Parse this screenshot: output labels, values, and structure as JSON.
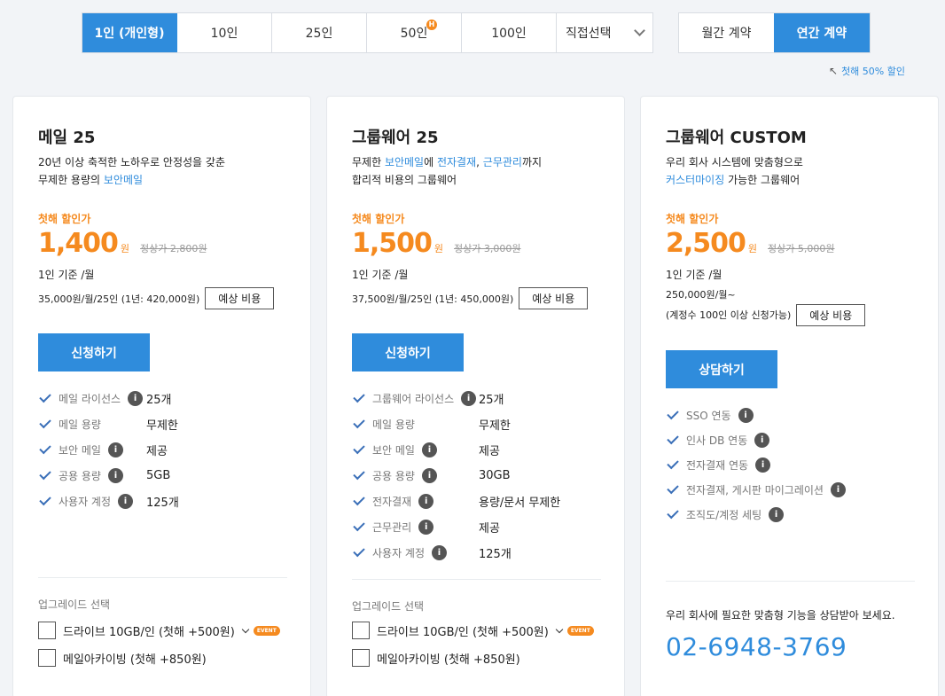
{
  "user_tabs": [
    {
      "label": "1인 (개인형)",
      "active": true
    },
    {
      "label": "10인"
    },
    {
      "label": "25인"
    },
    {
      "label": "50인",
      "badge": "H"
    },
    {
      "label": "100인"
    }
  ],
  "user_select_label": "직접선택",
  "contract_tabs": [
    {
      "label": "월간 계약"
    },
    {
      "label": "연간 계약",
      "active": true
    }
  ],
  "discount_note": "첫해 50% 할인",
  "cards": [
    {
      "name": "메일 25",
      "desc_line1": "20년 이상 축적한 노하우로 안정성을 갖춘",
      "desc_line2_pre": "무제한 용량의 ",
      "desc_line2_hl": "보안메일",
      "promo_label": "첫해 할인가",
      "price": "1,400",
      "won": "원",
      "original": "정상가 2,800원",
      "per": "1인 기준 /월",
      "calc": "35,000원/월/25인 (1년: 420,000원)",
      "estimate_label": "예상 비용",
      "button": "신청하기",
      "features": [
        {
          "name": "메일 라이선스",
          "info": true,
          "value": "25개"
        },
        {
          "name": "메일 용량",
          "info": false,
          "value": "무제한"
        },
        {
          "name": "보안 메일",
          "info": true,
          "value": "제공"
        },
        {
          "name": "공용 용량",
          "info": true,
          "value": "5GB"
        },
        {
          "name": "사용자 계정",
          "info": true,
          "value": "125개"
        }
      ],
      "upgrade_title": "업그레이드 선택",
      "upgrades": [
        {
          "label": "드라이브 10GB/인 (첫해 +500원)",
          "event": "EVENT"
        },
        {
          "label": "메일아카이빙 (첫해 +850원)"
        }
      ]
    },
    {
      "name": "그룹웨어 25",
      "desc_line1_pre": "무제한 ",
      "desc_line1_hl1": "보안메일",
      "desc_line1_mid": "에 ",
      "desc_line1_hl2": "전자결재",
      "desc_line1_comma": ", ",
      "desc_line1_hl3": "근무관리",
      "desc_line1_post": "까지",
      "desc_line2": "합리적 비용의 그룹웨어",
      "promo_label": "첫해 할인가",
      "price": "1,500",
      "won": "원",
      "original": "정상가 3,000원",
      "per": "1인 기준 /월",
      "calc": "37,500원/월/25인 (1년: 450,000원)",
      "estimate_label": "예상 비용",
      "button": "신청하기",
      "features": [
        {
          "name": "그룹웨어 라이선스",
          "info": true,
          "value": "25개"
        },
        {
          "name": "메일 용량",
          "info": false,
          "value": "무제한"
        },
        {
          "name": "보안 메일",
          "info": true,
          "value": "제공"
        },
        {
          "name": "공용 용량",
          "info": true,
          "value": "30GB"
        },
        {
          "name": "전자결재",
          "info": true,
          "value": "용량/문서 무제한"
        },
        {
          "name": "근무관리",
          "info": true,
          "value": "제공"
        },
        {
          "name": "사용자 계정",
          "info": true,
          "value": "125개"
        }
      ],
      "upgrade_title": "업그레이드 선택",
      "upgrades": [
        {
          "label": "드라이브 10GB/인 (첫해 +500원)",
          "event": "EVENT"
        },
        {
          "label": "메일아카이빙 (첫해 +850원)"
        }
      ]
    },
    {
      "name": "그룹웨어 CUSTOM",
      "desc_line1": "우리 회사 시스템에 맞춤형으로",
      "desc_line2_hl": "커스터마이징",
      "desc_line2_post": " 가능한 그룹웨어",
      "promo_label": "첫해 할인가",
      "price": "2,500",
      "won": "원",
      "original": "정상가 5,000원",
      "per": "1인 기준 /월",
      "calc_line1": "250,000원/월~",
      "calc_line2": "(계정수 100인 이상 신청가능)",
      "estimate_label": "예상 비용",
      "button": "상담하기",
      "features": [
        {
          "name": "SSO 연동",
          "info": true
        },
        {
          "name": "인사 DB 연동",
          "info": true
        },
        {
          "name": "전자결재 연동",
          "info": true
        },
        {
          "name": "전자결재, 게시판 마이그레이션",
          "info": true
        },
        {
          "name": "조직도/계정 세팅",
          "info": true
        }
      ],
      "contact_msg": "우리 회사에 필요한 맞춤형 기능을 상담받아 보세요.",
      "phone": "02-6948-3769"
    }
  ],
  "colors": {
    "accent": "#2f8cdc",
    "price": "#f58a1f"
  }
}
